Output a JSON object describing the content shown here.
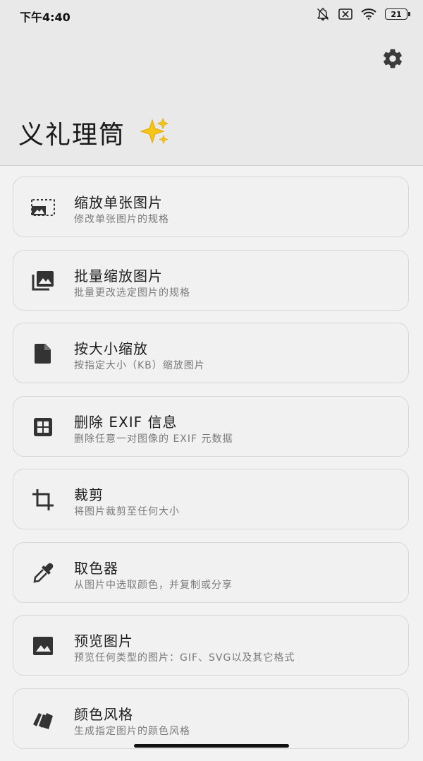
{
  "status": {
    "time": "下午4:40",
    "battery": "21"
  },
  "header": {
    "title": "义礼理筒",
    "emoji": "✨"
  },
  "items": [
    {
      "title": "缩放单张图片",
      "subtitle": "修改单张图片的规格",
      "icon": "photo-size-select-icon"
    },
    {
      "title": "批量缩放图片",
      "subtitle": "批量更改选定图片的规格",
      "icon": "photo-library-icon"
    },
    {
      "title": "按大小缩放",
      "subtitle": "按指定大小（KB）缩放图片",
      "icon": "file-icon"
    },
    {
      "title": "删除 EXIF 信息",
      "subtitle": "删除任意一对图像的 EXIF 元数据",
      "icon": "grid-icon"
    },
    {
      "title": "裁剪",
      "subtitle": "将图片裁剪至任何大小",
      "icon": "crop-icon"
    },
    {
      "title": "取色器",
      "subtitle": "从图片中选取颜色，并复制或分享",
      "icon": "eyedropper-icon"
    },
    {
      "title": "预览图片",
      "subtitle": "预览任何类型的图片：GIF、SVG以及其它格式",
      "icon": "image-icon"
    },
    {
      "title": "颜色风格",
      "subtitle": "生成指定图片的颜色风格",
      "icon": "palette-swatch-icon"
    }
  ]
}
